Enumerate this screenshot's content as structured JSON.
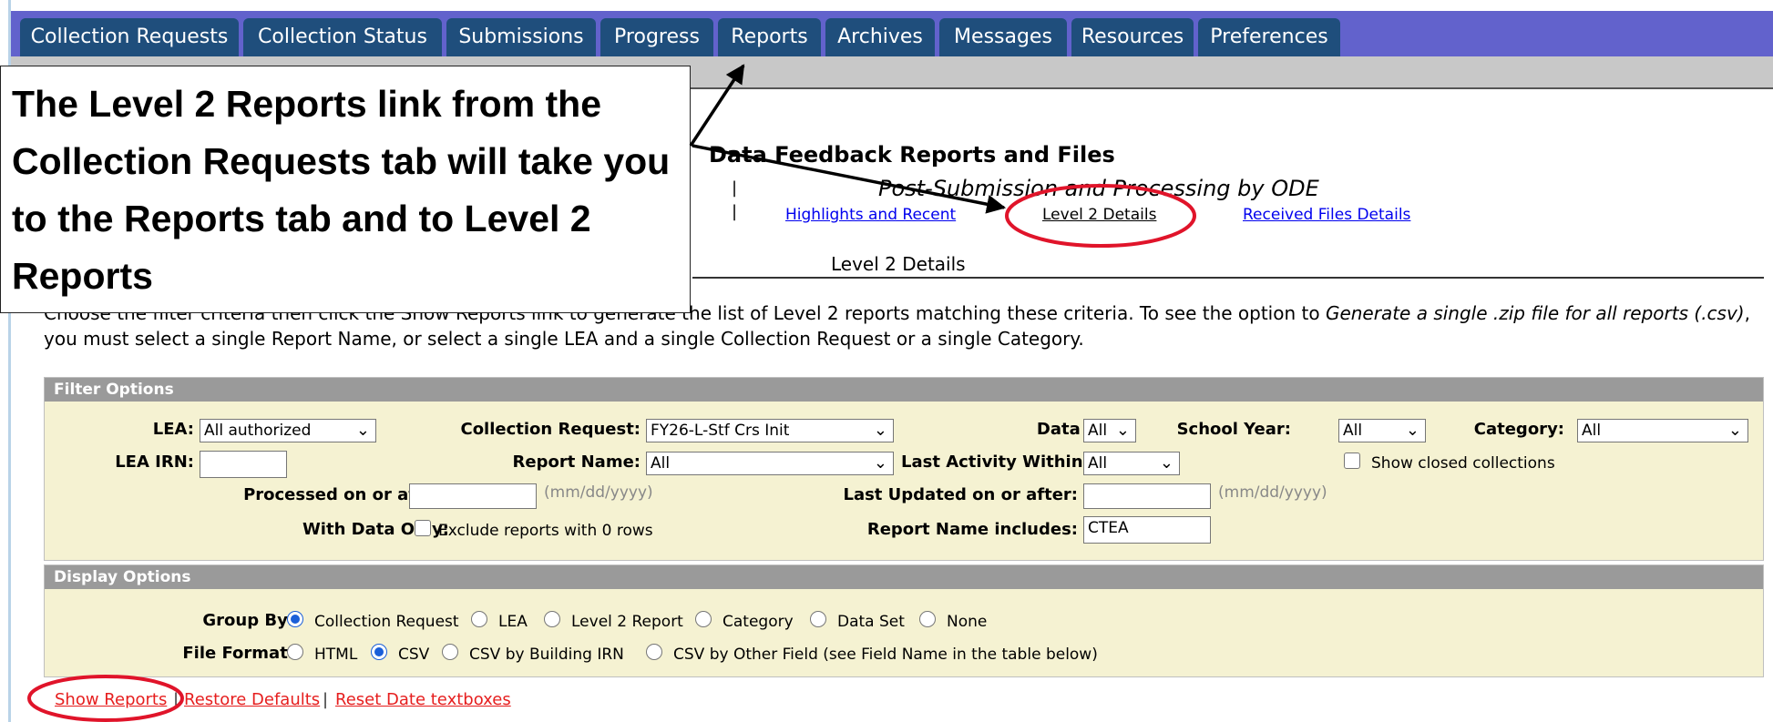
{
  "tabs": [
    {
      "label": "Collection Requests"
    },
    {
      "label": "Collection Status"
    },
    {
      "label": "Submissions"
    },
    {
      "label": "Progress"
    },
    {
      "label": "Reports"
    },
    {
      "label": "Archives"
    },
    {
      "label": "Messages"
    },
    {
      "label": "Resources"
    },
    {
      "label": "Preferences"
    }
  ],
  "page": {
    "title": "Data Feedback Reports and Files",
    "subtitle": "Post-Submission and Processing by ODE",
    "separator": "|",
    "links": [
      {
        "label": "Highlights and Recent"
      },
      {
        "label": "Level 2 Details"
      },
      {
        "label": "Received Files Details"
      }
    ],
    "section_heading": "Level 2 Details",
    "intro_part1": "Choose the filter criteria then click the Show Reports link to generate the list of Level 2 reports matching these criteria. To see the option to ",
    "intro_italic": "Generate a single .zip file for all reports (.csv)",
    "intro_part2": ", you must select a single Report Name, or select a single LEA and a single Collection Request or a single Category."
  },
  "filter": {
    "heading": "Filter Options",
    "lea_label": "LEA:",
    "lea_value": "All authorized",
    "collection_request_label": "Collection Request:",
    "collection_request_value": "FY26-L-Stf Crs Init",
    "data_set_label": "Data Set:",
    "data_set_value": "All",
    "school_year_label": "School Year:",
    "school_year_value": "All",
    "category_label": "Category:",
    "category_value": "All",
    "lea_irn_label": "LEA IRN:",
    "lea_irn_value": "",
    "report_name_label": "Report Name:",
    "report_name_value": "All",
    "last_activity_label": "Last Activity Within:",
    "last_activity_value": "All",
    "show_closed_label": "Show closed collections",
    "processed_label": "Processed on or after:",
    "processed_value": "",
    "date_hint": "(mm/dd/yyyy)",
    "last_updated_label": "Last Updated on or after:",
    "last_updated_value": "",
    "with_data_label": "With Data Only:",
    "exclude_label": "Exclude reports with 0 rows",
    "report_name_includes_label": "Report Name includes:",
    "report_name_includes_value": "CTEA"
  },
  "display": {
    "heading": "Display Options",
    "group_by_label": "Group By:",
    "group_by_options": [
      "Collection Request",
      "LEA",
      "Level 2 Report",
      "Category",
      "Data Set",
      "None"
    ],
    "group_by_selected": "Collection Request",
    "file_format_label": "File Format:",
    "file_format_options": [
      "HTML",
      "CSV",
      "CSV by Building IRN",
      "CSV by Other Field (see Field Name in the table below)"
    ],
    "file_format_selected": "CSV"
  },
  "actions": {
    "show_reports": "Show Reports",
    "restore_defaults": "Restore Defaults",
    "reset_dates": "Reset Date textboxes",
    "separator": "|"
  },
  "callout": {
    "text": "The Level 2 Reports link from the Collection Requests tab will take you to the Reports tab and to Level 2 Reports"
  },
  "colors": {
    "tab_bg": "#1f4e7c",
    "tabbar_bg": "#6262cc",
    "highlight_oval": "#e0142a",
    "action_link": "#e61e1e"
  }
}
